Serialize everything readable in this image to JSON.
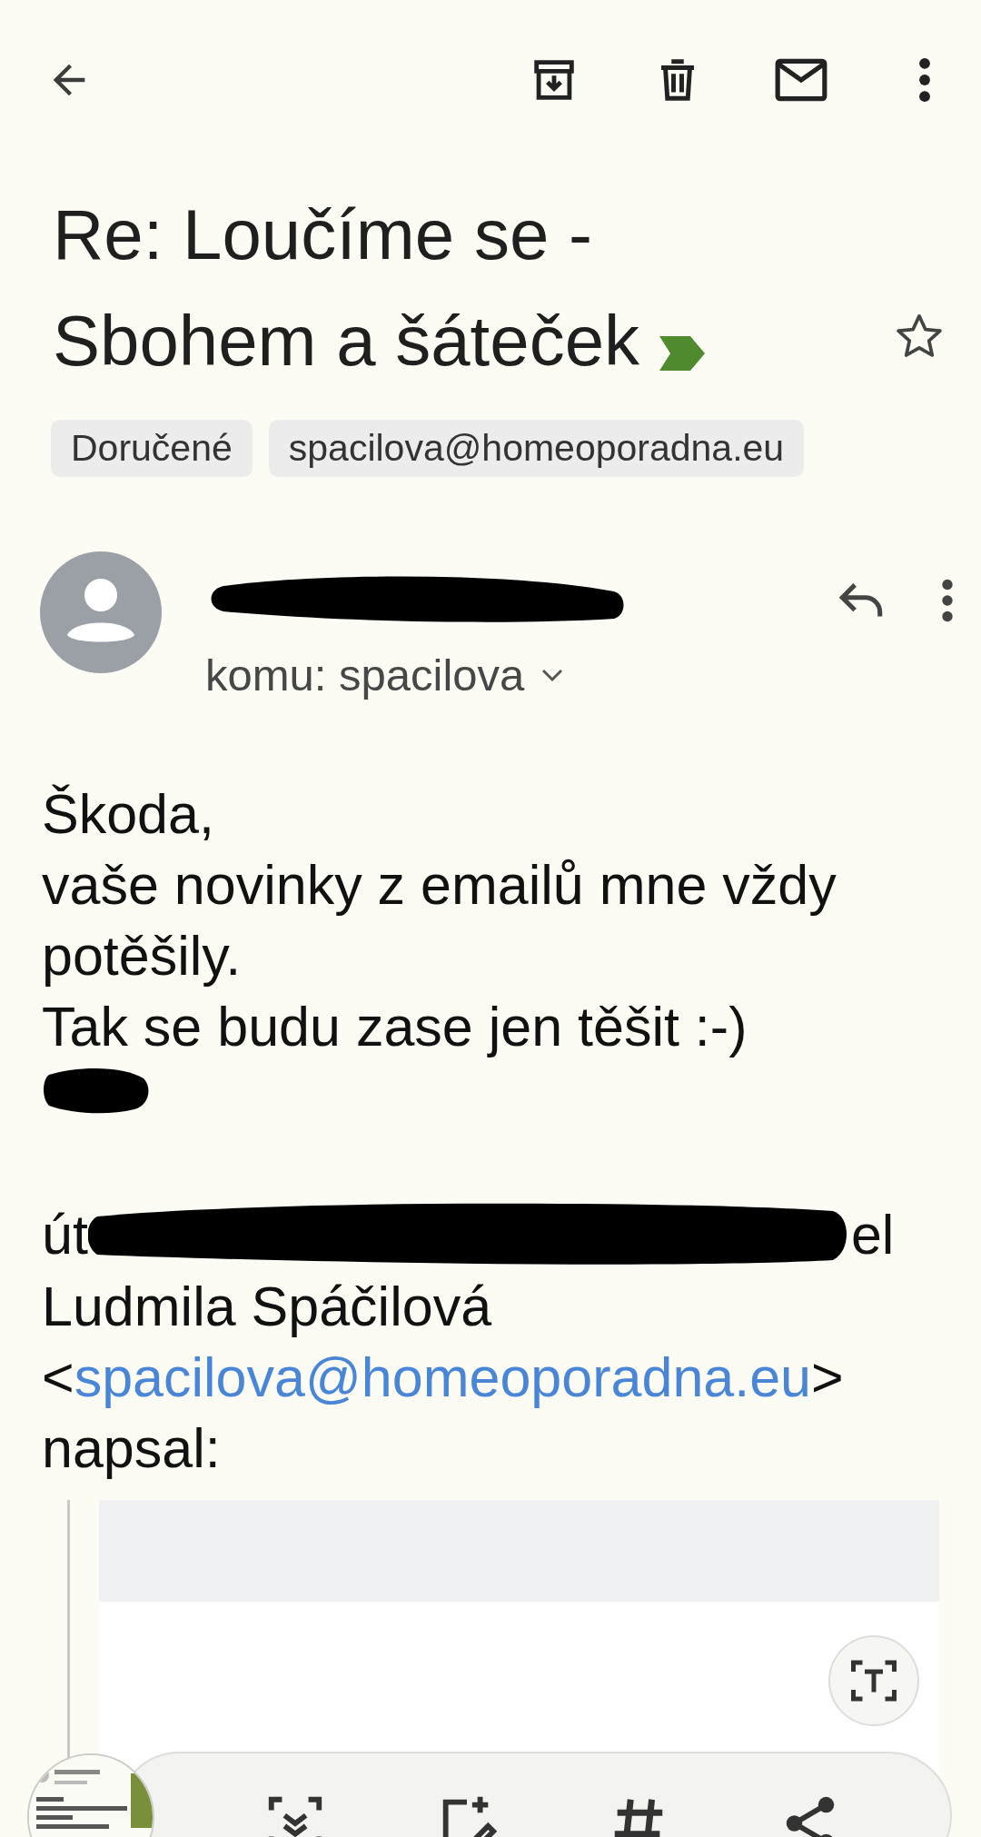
{
  "subject": {
    "title": "Re: Loučíme se - Sbohem a šáteček",
    "important": true,
    "starred": false
  },
  "labels": [
    "Doručené",
    "spacilova@homeoporadna.eu"
  ],
  "message": {
    "recipient": "komu: spacilova",
    "body": [
      "Škoda,",
      "vaše novinky z emailů mne vždy",
      "potěšily.",
      "Tak se budu zase jen těšit :-)"
    ],
    "quote_header": {
      "date_start": "út",
      "date_end": "el",
      "name": "Ludmila Spáčilová",
      "email_open": "<",
      "email": "spacilova@homeoporadna.eu",
      "email_close": ">",
      "wrote": "napsal:"
    }
  }
}
